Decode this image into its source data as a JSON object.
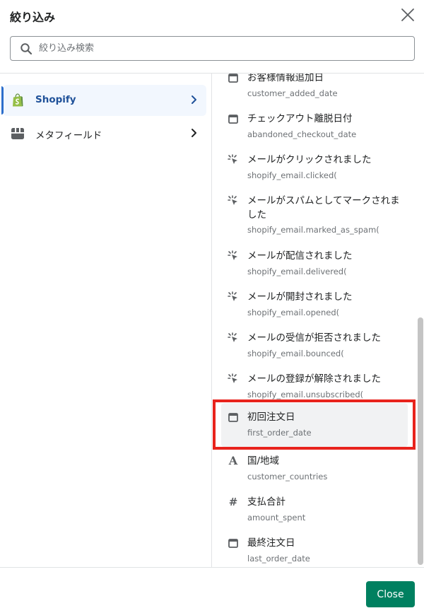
{
  "header": {
    "title": "絞り込み",
    "close_icon": "close-icon"
  },
  "search": {
    "placeholder": "絞り込み検索",
    "icon": "search-icon"
  },
  "sidebar": {
    "items": [
      {
        "label": "Shopify",
        "icon": "shopify-bag-icon",
        "active": true
      },
      {
        "label": "メタフィールド",
        "icon": "metafield-icon",
        "active": false
      }
    ]
  },
  "fields": [
    {
      "label": "お客様情報追加日",
      "key": "customer_added_date",
      "icon": "calendar-icon"
    },
    {
      "label": "チェックアウト離脱日付",
      "key": "abandoned_checkout_date",
      "icon": "calendar-icon"
    },
    {
      "label": "メールがクリックされました",
      "key": "shopify_email.clicked(",
      "icon": "click-icon"
    },
    {
      "label": "メールがスパムとしてマークされました",
      "key": "shopify_email.marked_as_spam(",
      "icon": "click-icon"
    },
    {
      "label": "メールが配信されました",
      "key": "shopify_email.delivered(",
      "icon": "click-icon"
    },
    {
      "label": "メールが開封されました",
      "key": "shopify_email.opened(",
      "icon": "click-icon"
    },
    {
      "label": "メールの受信が拒否されました",
      "key": "shopify_email.bounced(",
      "icon": "click-icon"
    },
    {
      "label": "メールの登録が解除されました",
      "key": "shopify_email.unsubscribed(",
      "icon": "click-icon"
    },
    {
      "label": "初回注文日",
      "key": "first_order_date",
      "icon": "calendar-icon",
      "highlighted": true
    },
    {
      "label": "国/地域",
      "key": "customer_countries",
      "icon": "text-icon"
    },
    {
      "label": "支払合計",
      "key": "amount_spent",
      "icon": "hash-icon"
    },
    {
      "label": "最終注文日",
      "key": "last_order_date",
      "icon": "calendar-icon"
    }
  ],
  "footer": {
    "close_label": "Close"
  },
  "colors": {
    "accent": "#2c6ecb",
    "primary_button": "#008060",
    "highlight_border": "#e8231c"
  }
}
